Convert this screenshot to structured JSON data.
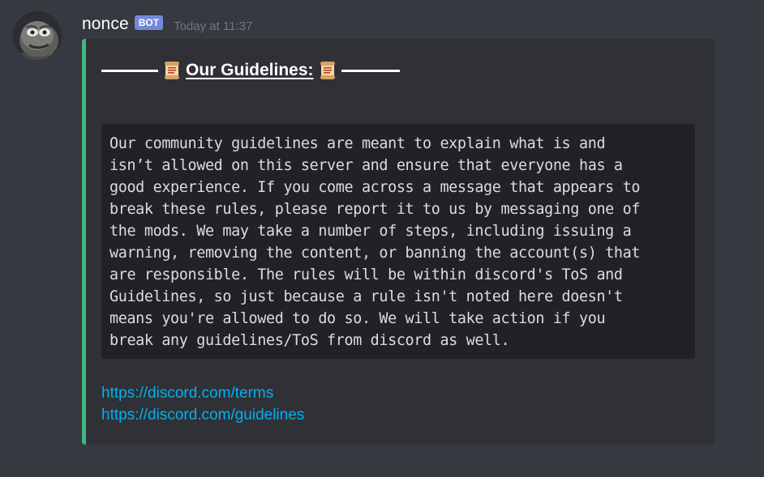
{
  "message": {
    "username": "nonce",
    "bot_tag": "BOT",
    "timestamp": "Today at 11:37",
    "avatar_icon": "pepe-avatar-icon"
  },
  "embed": {
    "accent_color": "#43b581",
    "title": "Our Guidelines:",
    "title_emoji": "scroll-icon",
    "code_lines": [
      "Our community guidelines are meant to explain what is and",
      "isn’t allowed on this server and ensure that everyone has a",
      "good experience. If you come across a message that appears to",
      "break these rules, please report it to us by messaging one of",
      "the mods. We may take a number of steps, including issuing a",
      "warning, removing the content, or banning the account(s) that",
      "are responsible. The rules will be within discord's ToS and",
      "Guidelines, so just because a rule isn't noted here doesn't",
      "means you're allowed to do so. We will take action if you",
      "break any guidelines/ToS from discord as well."
    ],
    "links": [
      "https://discord.com/terms",
      "https://discord.com/guidelines"
    ]
  },
  "colors": {
    "background": "#36393f",
    "embed_background": "#2f3136",
    "codeblock_background": "#202225",
    "link": "#00b0f4",
    "bot_tag": "#7289da"
  }
}
